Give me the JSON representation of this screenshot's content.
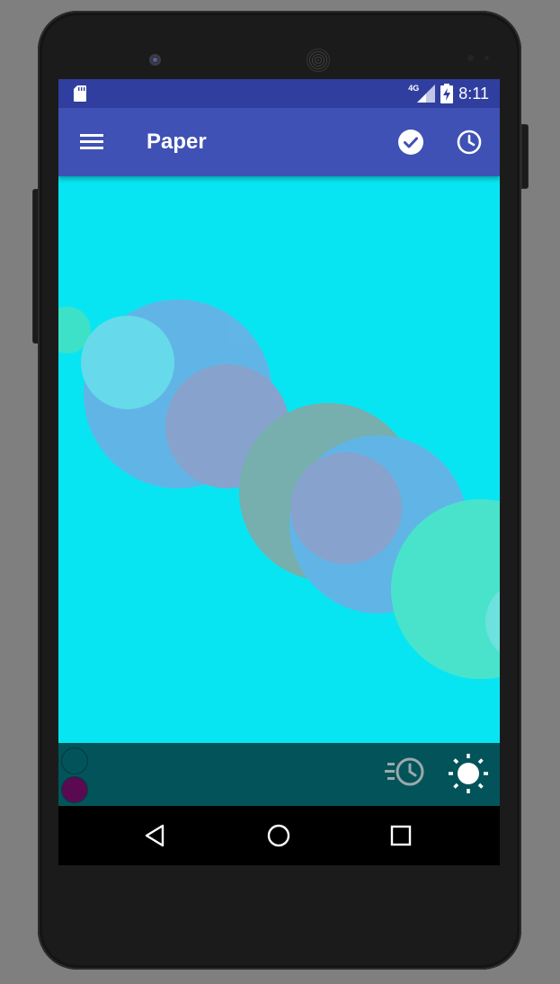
{
  "status_bar": {
    "network_label": "4G",
    "time": "8:11",
    "icons": [
      "sd-card-icon",
      "signal-icon",
      "battery-charging-icon"
    ]
  },
  "app_bar": {
    "menu_icon": "menu-icon",
    "title": "Paper",
    "actions": [
      "check-circle-icon",
      "history-icon"
    ]
  },
  "canvas": {
    "background": "#08e5f2",
    "circle_colors": [
      "#6cb0e6",
      "#a79ac8",
      "#8ea99f",
      "#35e6c6",
      "#79d3e6",
      "#7dd4b2"
    ]
  },
  "bottom_toolbar": {
    "background": "#03545a",
    "swatches": [
      {
        "name": "teal",
        "color": "#03545a"
      },
      {
        "name": "purple",
        "color": "#5b0a52"
      }
    ],
    "actions": [
      "recent-history-icon",
      "brightness-icon"
    ]
  },
  "nav_bar": {
    "buttons": [
      "back-icon",
      "home-icon",
      "recents-icon"
    ]
  }
}
